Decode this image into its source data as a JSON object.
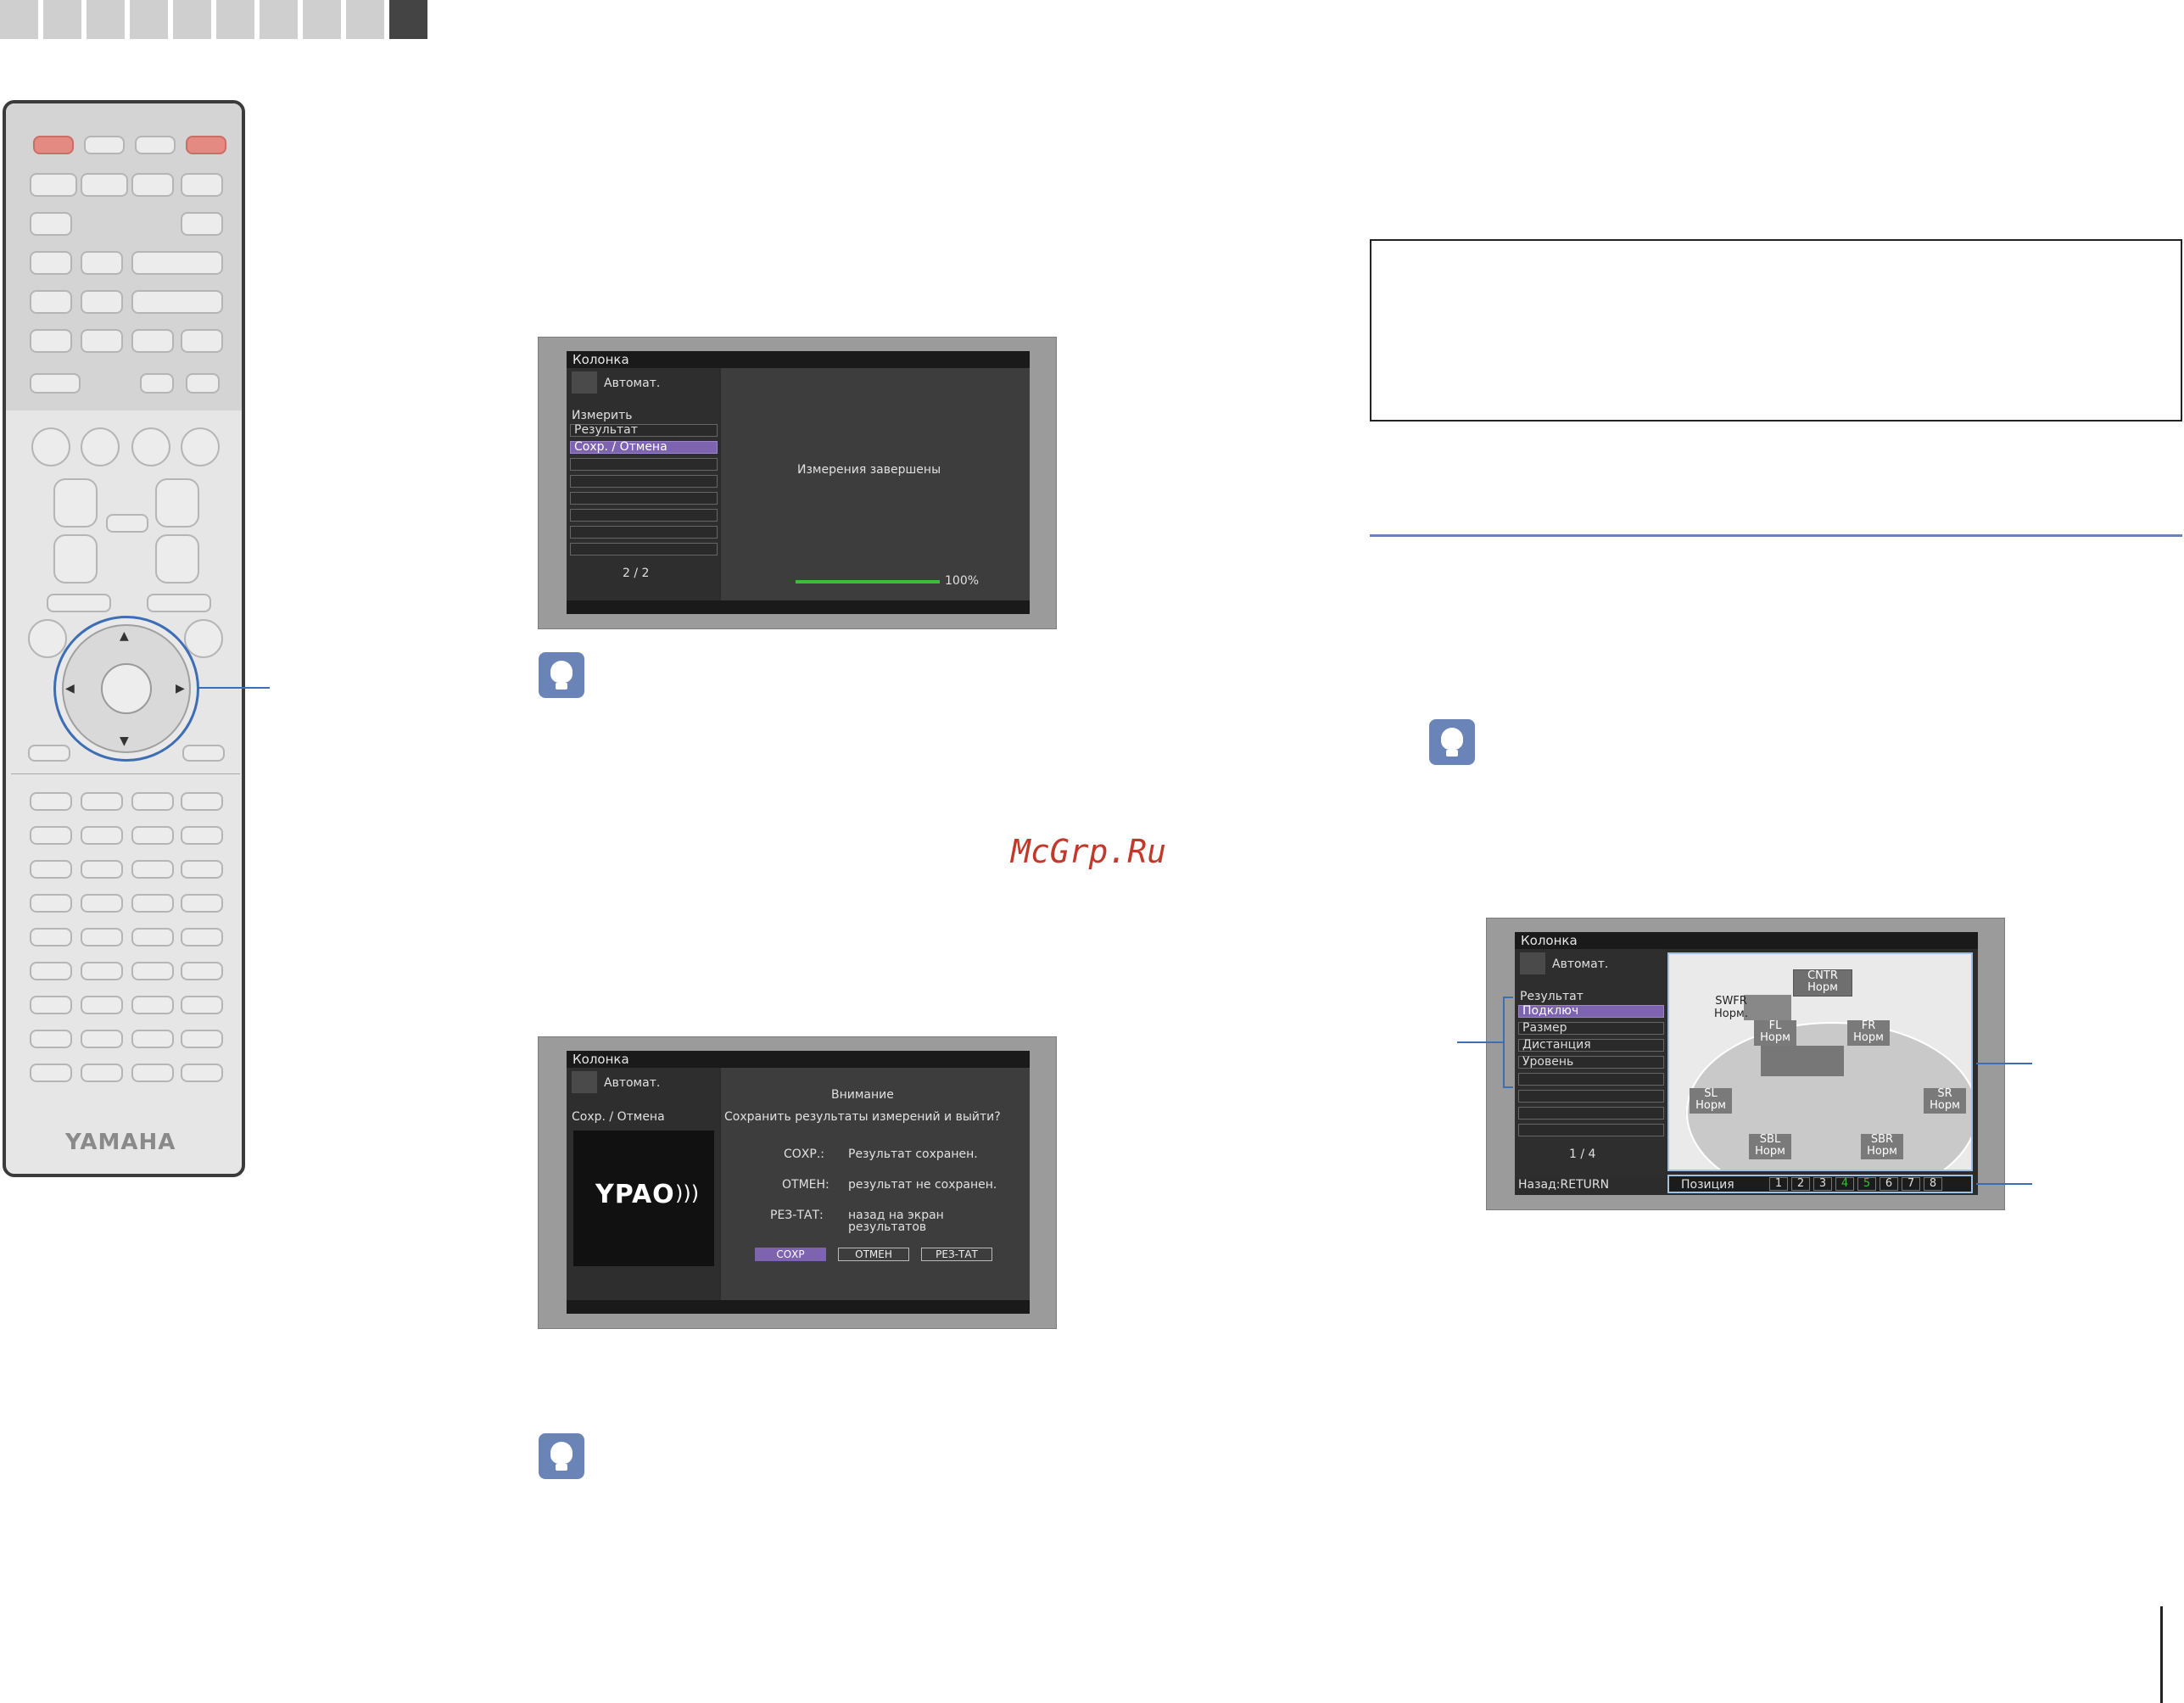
{
  "watermark": "McGrp.Ru",
  "brand": {
    "name": "YAMAHA"
  },
  "screen1": {
    "title": "Колонка",
    "mode": "Автомат.",
    "section": "Измерить",
    "items": [
      "Результат",
      "Сохр. / Отмена"
    ],
    "page": "2 / 2",
    "message": "Измерения завершены",
    "progress_label": "100%",
    "progress": 1.0
  },
  "screen2": {
    "title": "Колонка",
    "mode": "Автомат.",
    "section": "Сохр. / Отмена",
    "logo_text": "YPAO",
    "heading": "Внимание",
    "question": "Сохранить результаты измерений и выйти?",
    "options": [
      {
        "key": "СОХР.:",
        "desc": "Результат сохранен."
      },
      {
        "key": "ОТМЕН:",
        "desc": "результат не сохранен."
      },
      {
        "key": "РЕЗ-ТАТ:",
        "desc": "назад на экран",
        "desc2": "результатов"
      }
    ],
    "buttons": [
      "СОХР",
      "ОТМЕН",
      "РЕЗ-ТАТ"
    ]
  },
  "screen3": {
    "title": "Колонка",
    "mode": "Автомат.",
    "section": "Результат",
    "items": [
      "Подключ",
      "Размер",
      "Дистанция",
      "Уровень"
    ],
    "page": "1 / 4",
    "back": "Назад:RETURN",
    "position_label": "Позиция",
    "positions": [
      "1",
      "2",
      "3",
      "4",
      "5",
      "6",
      "7",
      "8"
    ],
    "speakers": [
      {
        "name": "CNTR",
        "status": "Норм"
      },
      {
        "name": "SWFR",
        "status": "Норм."
      },
      {
        "name": "FL",
        "status": "Норм"
      },
      {
        "name": "FR",
        "status": "Норм"
      },
      {
        "name": "SL",
        "status": "Норм"
      },
      {
        "name": "SR",
        "status": "Норм"
      },
      {
        "name": "SBL",
        "status": "Норм"
      },
      {
        "name": "SBR",
        "status": "Норм"
      }
    ]
  },
  "colors": {
    "accent": "#3d6db5",
    "selection": "#7d63b0",
    "watermark": "#c0392b",
    "progress": "#3cbd3c"
  }
}
